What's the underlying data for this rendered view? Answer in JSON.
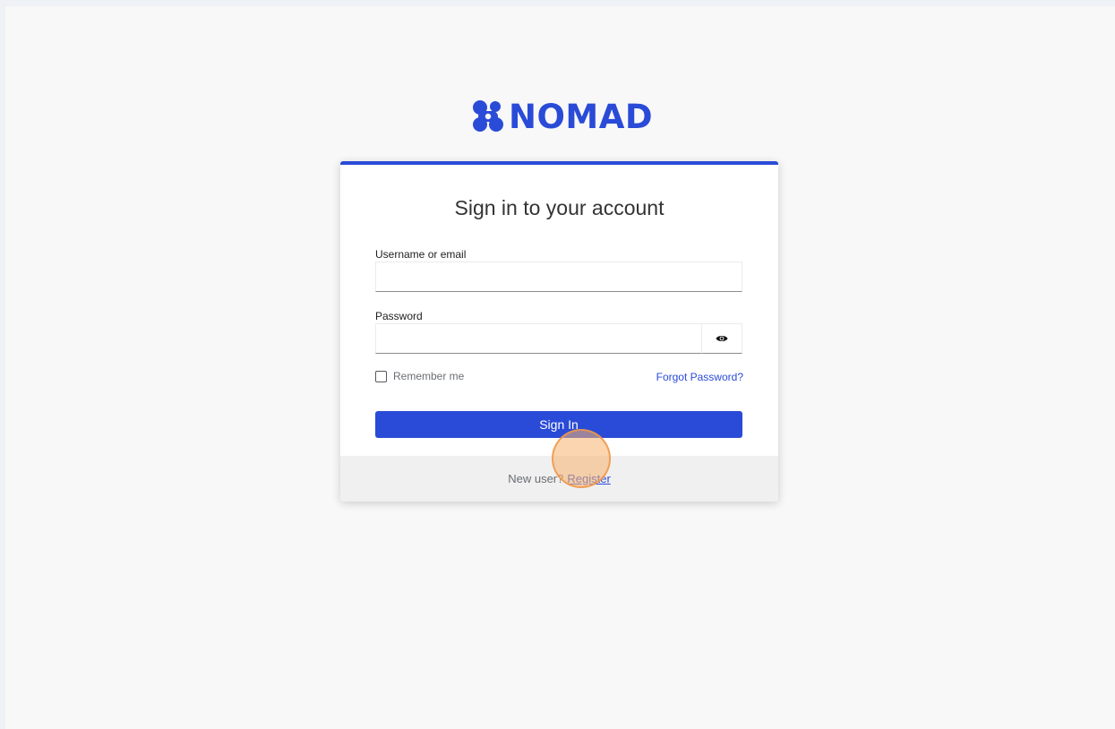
{
  "brand": {
    "name": "NOMAD",
    "color": "#2a4bd7"
  },
  "login": {
    "title": "Sign in to your account",
    "username_label": "Username or email",
    "username_value": "",
    "password_label": "Password",
    "password_value": "",
    "show_password_icon": "eye-icon",
    "remember_label": "Remember me",
    "remember_checked": false,
    "forgot_link": "Forgot Password?",
    "signin_label": "Sign In"
  },
  "footer": {
    "prompt": "New user?",
    "register_link": "Register"
  },
  "colors": {
    "accent": "#2a4bd7",
    "page_bg": "#f8f8f8",
    "footer_bg": "#f0f0f0",
    "click_indicator": "#f7b26e"
  }
}
